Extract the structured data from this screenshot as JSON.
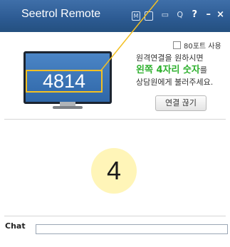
{
  "window": {
    "title": "Seetrol Remote",
    "title_icons": [
      "M",
      "□",
      "▭",
      "Q",
      "?",
      "–",
      "×"
    ]
  },
  "connect": {
    "code": "4814",
    "port_label": "80포트 사용",
    "instruction_line1": "원격연결을 원하시면",
    "instruction_em": "왼쪽 4자리 숫자",
    "instruction_em_suffix": "를",
    "instruction_line3": "상담원에게 불러주세요.",
    "disconnect_label": "연결 끊기"
  },
  "step_number": "4",
  "chat": {
    "label": "Chat",
    "value": ""
  }
}
